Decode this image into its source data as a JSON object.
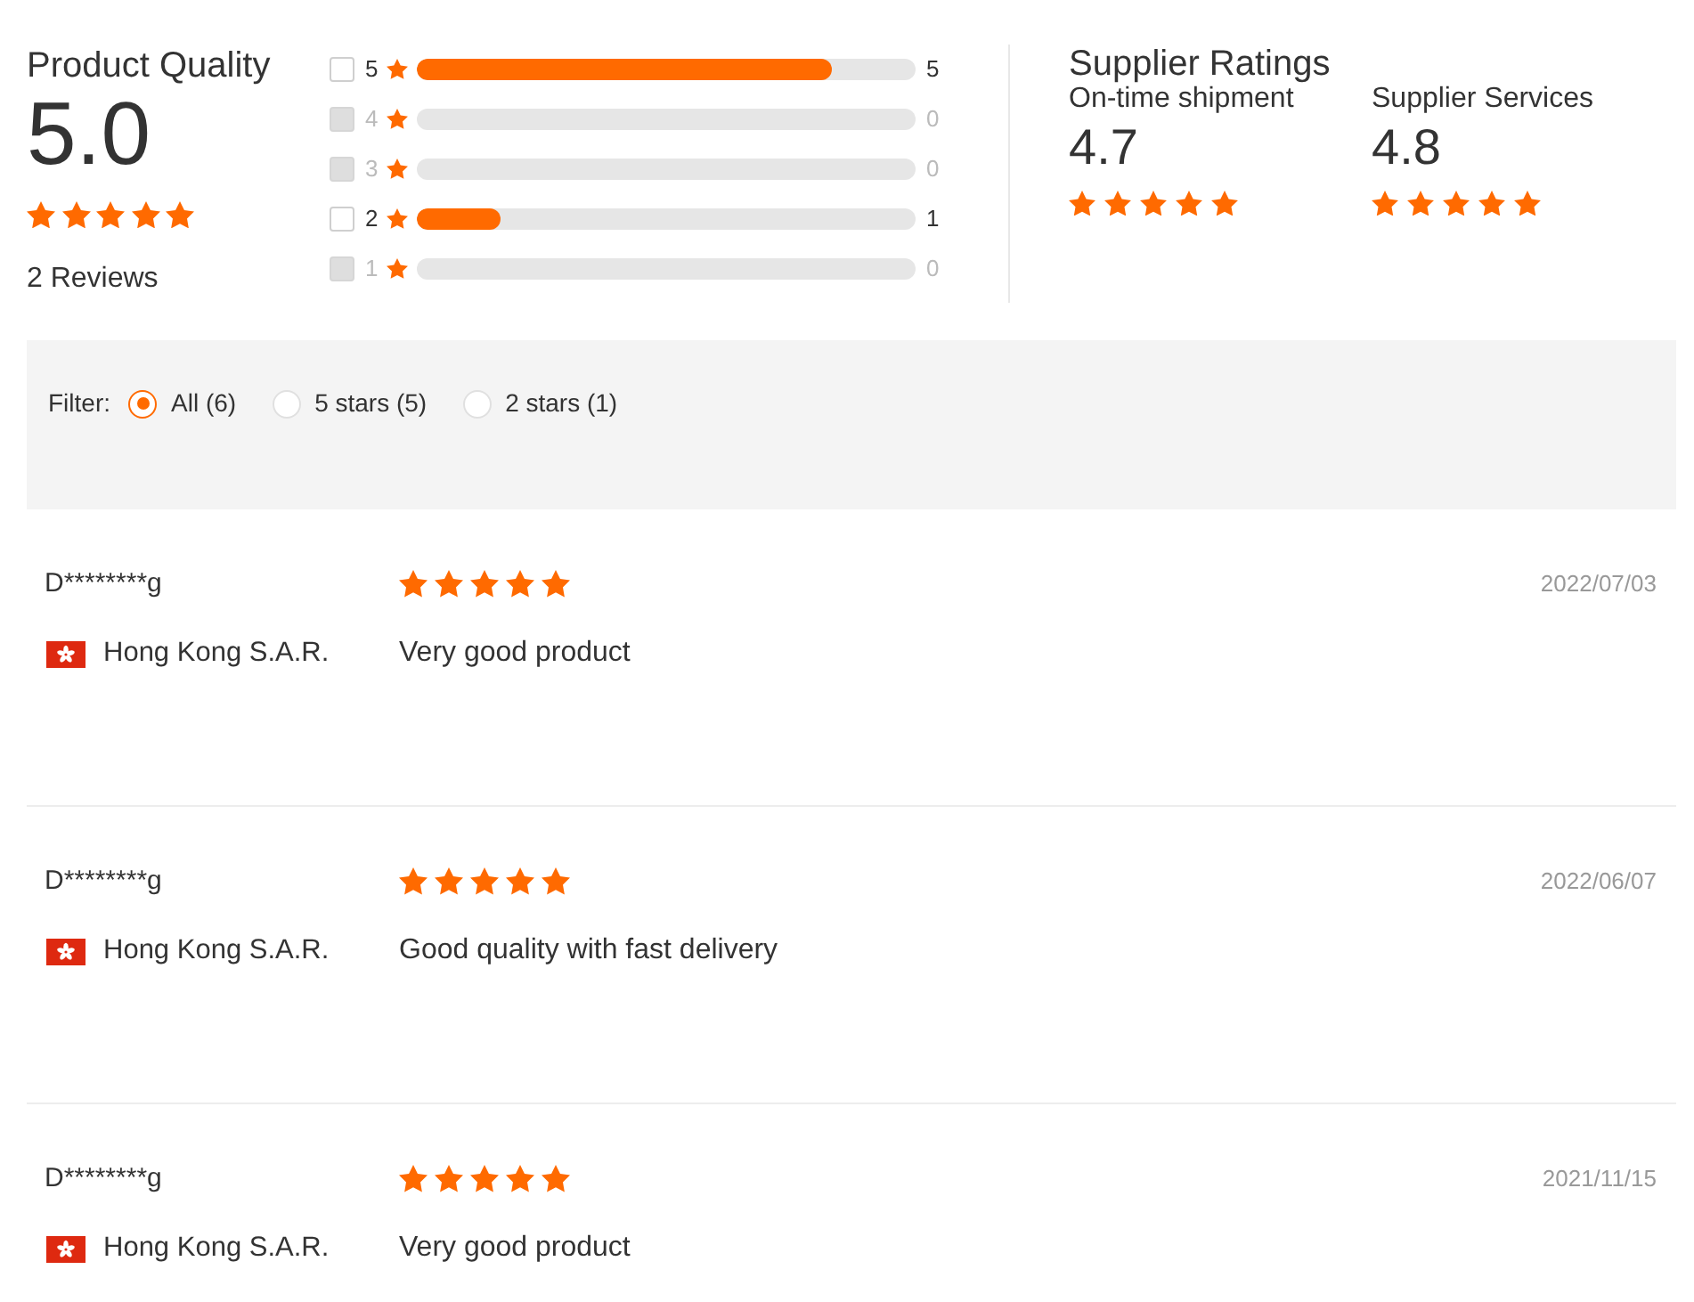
{
  "product_quality": {
    "title": "Product Quality",
    "score": "5.0",
    "stars": 5,
    "reviews": "2 Reviews"
  },
  "breakdown": [
    {
      "label": "5",
      "count": "5",
      "level": 0.833,
      "checked": false,
      "disabled": false
    },
    {
      "label": "4",
      "count": "0",
      "level": 0,
      "checked": false,
      "disabled": true
    },
    {
      "label": "3",
      "count": "0",
      "level": 0,
      "checked": false,
      "disabled": true
    },
    {
      "label": "2",
      "count": "1",
      "level": 0.167,
      "checked": false,
      "disabled": false
    },
    {
      "label": "1",
      "count": "0",
      "level": 0,
      "checked": false,
      "disabled": true
    }
  ],
  "supplier_ratings": {
    "title": "Supplier Ratings",
    "items": [
      {
        "label": "On-time shipment",
        "score": "4.7",
        "stars": 5
      },
      {
        "label": "Supplier Services",
        "score": "4.8",
        "stars": 5
      }
    ]
  },
  "filter": {
    "label": "Filter:",
    "options": [
      {
        "label": "All (6)",
        "selected": true
      },
      {
        "label": "5 stars (5)",
        "selected": false
      },
      {
        "label": "2 stars (1)",
        "selected": false
      }
    ]
  },
  "reviews": [
    {
      "name": "D********g",
      "stars": 5,
      "date": "2022/07/03",
      "country": "Hong Kong S.A.R.",
      "comment": "Very good product"
    },
    {
      "name": "D********g",
      "stars": 5,
      "date": "2022/06/07",
      "country": "Hong Kong S.A.R.",
      "comment": "Good quality with fast delivery"
    },
    {
      "name": "D********g",
      "stars": 5,
      "date": "2021/11/15",
      "country": "Hong Kong S.A.R.",
      "comment": "Very good product"
    }
  ]
}
